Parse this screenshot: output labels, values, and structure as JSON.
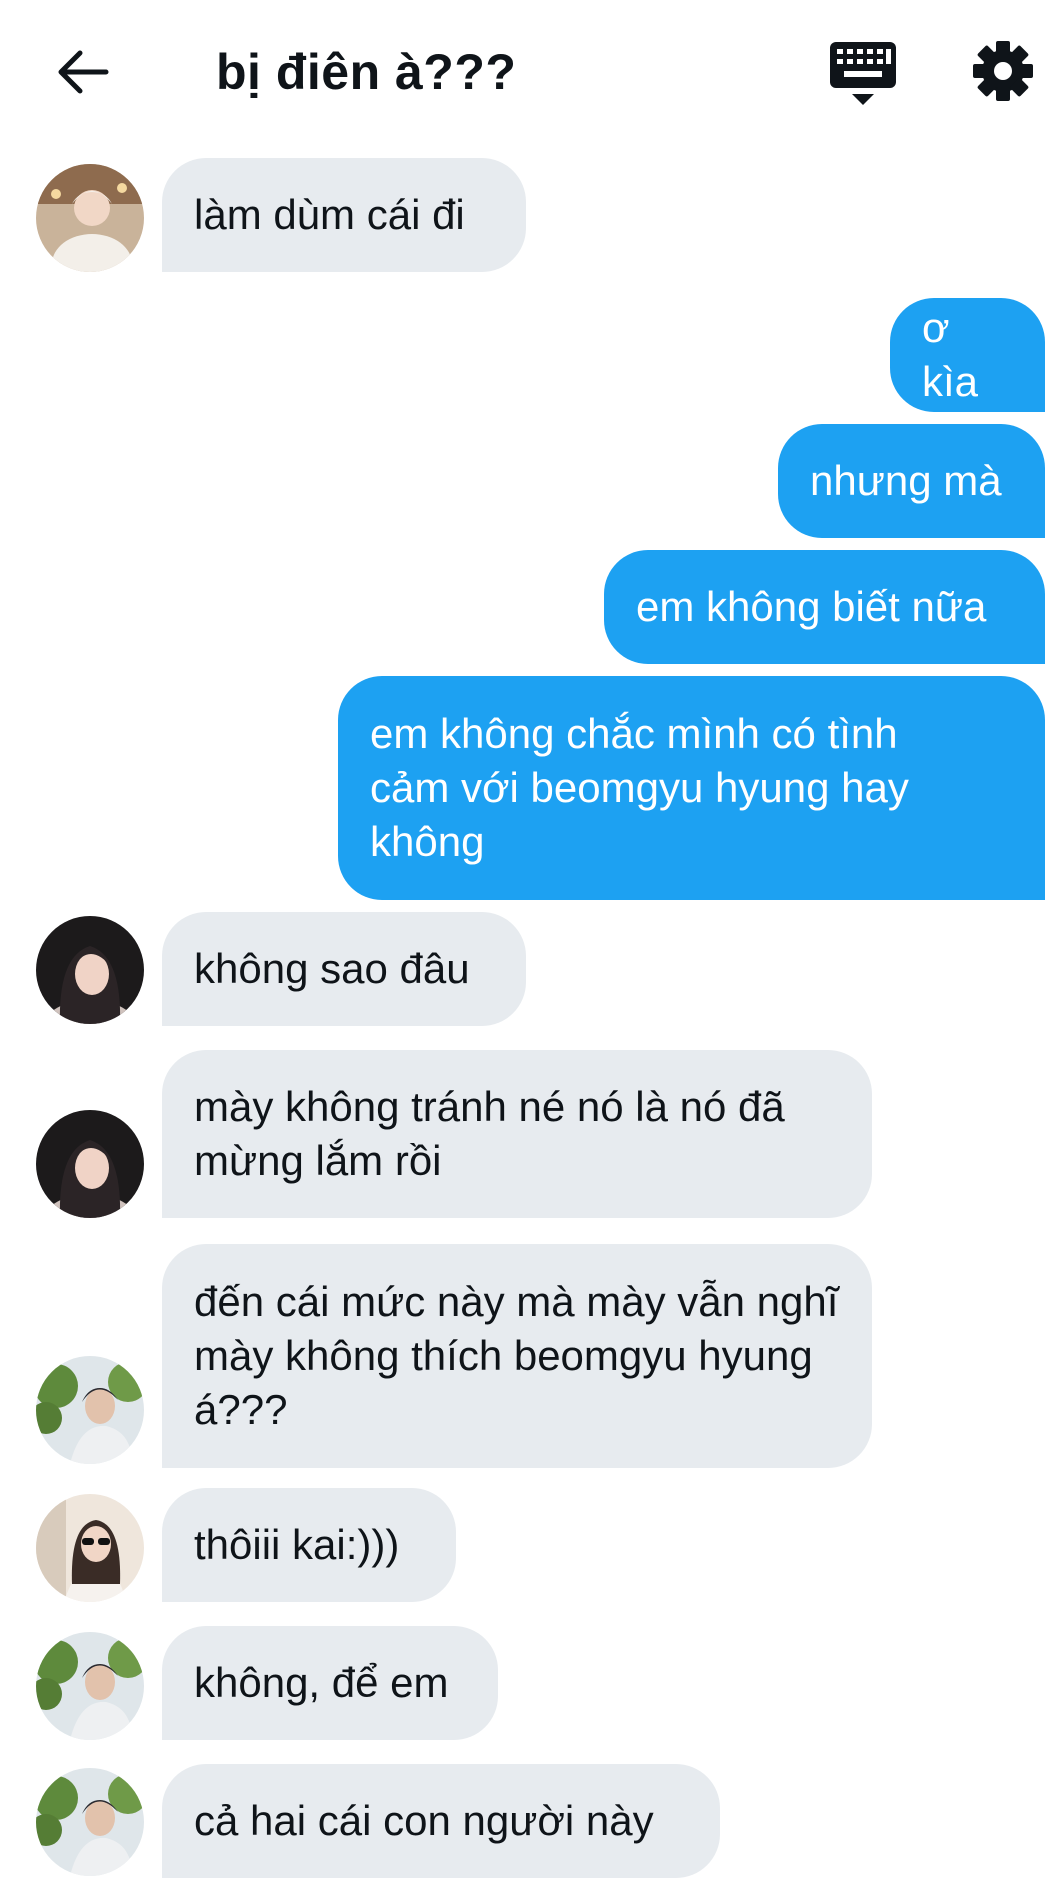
{
  "header": {
    "title": "bị điên à???",
    "back_icon": "arrow-left-icon",
    "keyboard_icon": "keyboard-icon",
    "settings_icon": "gear-icon"
  },
  "colors": {
    "outgoing_bubble": "#1da1f2",
    "incoming_bubble": "#e7ebef",
    "text": "#0f1419"
  },
  "messages": [
    {
      "direction": "incoming",
      "text": "làm dùm cái đi"
    },
    {
      "direction": "outgoing",
      "text": "ơ kìa"
    },
    {
      "direction": "outgoing",
      "text": "nhưng mà"
    },
    {
      "direction": "outgoing",
      "text": "em không biết nữa"
    },
    {
      "direction": "outgoing",
      "text": "em không chắc mình có tình cảm với beomgyu hyung hay không"
    },
    {
      "direction": "incoming",
      "text": "không sao đâu"
    },
    {
      "direction": "incoming",
      "text": "mày không tránh né nó là nó đã mừng lắm rồi"
    },
    {
      "direction": "incoming",
      "text": "đến cái mức này mà mày vẫn nghĩ mày không thích beomgyu hyung á???"
    },
    {
      "direction": "incoming",
      "text": "thôiii kai:)))"
    },
    {
      "direction": "incoming",
      "text": "không, để em"
    },
    {
      "direction": "incoming",
      "text": "cả hai cái con người này"
    }
  ]
}
